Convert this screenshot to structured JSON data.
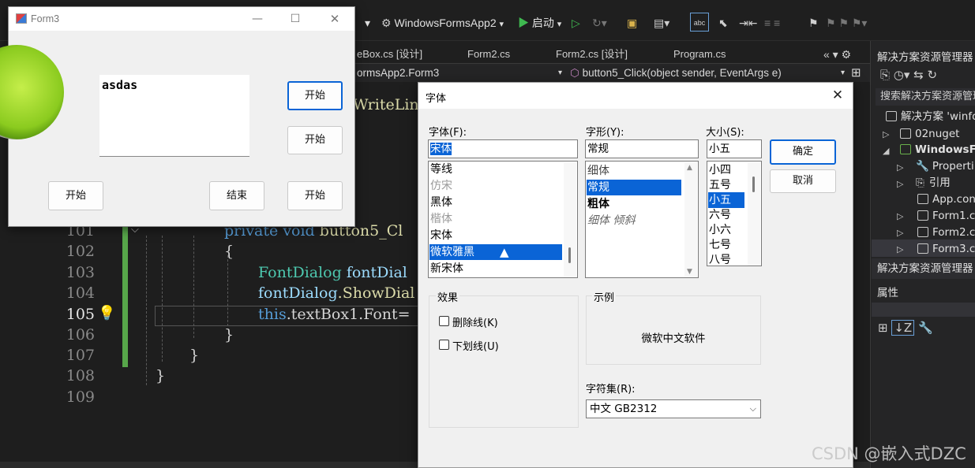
{
  "vs": {
    "toolbar": {
      "project_name": "WindowsFormsApp2",
      "run_label": "启动"
    },
    "tabs": [
      "eBox.cs [设计]",
      "Form2.cs",
      "Form2.cs [设计]",
      "Program.cs"
    ],
    "nav": {
      "class_combo": "ormsApp2.Form3",
      "member_combo": "button5_Click(object sender, EventArgs e)"
    },
    "code_partial": "WriteLin",
    "line_numbers": [
      "101",
      "102",
      "103",
      "104",
      "105",
      "106",
      "107",
      "108",
      "109"
    ],
    "current_line": "105",
    "code_lines": {
      "l101": {
        "kw1": "private",
        "kw2": "void",
        "fn": "button5_Cl"
      },
      "l102": "{",
      "l103": {
        "ty": "FontDialog",
        "vr": "fontDial"
      },
      "l104": {
        "vr": "fontDialog",
        "fn": ".ShowDial"
      },
      "l105": {
        "kw": "this",
        "rest": ".textBox1.Font="
      },
      "l106": "}",
      "l107": "}",
      "l108": "}"
    }
  },
  "solution_explorer": {
    "title": "解决方案资源管理器",
    "search_placeholder": "搜索解决方案资源管理",
    "items": [
      {
        "label": "解决方案 'winfo"
      },
      {
        "label": "02nuget"
      },
      {
        "label": "WindowsFo"
      },
      {
        "label": "Properti"
      },
      {
        "label": "引用"
      },
      {
        "label": "App.con"
      },
      {
        "label": "Form1.c"
      },
      {
        "label": "Form2.c"
      },
      {
        "label": "Form3.c"
      }
    ],
    "footer_title": "解决方案资源管理器",
    "properties_title": "属性"
  },
  "form3": {
    "title": "Form3",
    "textbox_text": "asdas",
    "buttons": {
      "right_top": "开始",
      "right_mid": "开始",
      "bottom_left": "开始",
      "bottom_mid": "结束",
      "bottom_right": "开始"
    }
  },
  "font_dialog": {
    "title": "字体",
    "font_label": "字体(F):",
    "font_value": "宋体",
    "font_list": [
      "等线",
      "仿宋",
      "黑体",
      "楷体",
      "宋体",
      "微软雅黑",
      "新宋体"
    ],
    "font_selected": "微软雅黑",
    "style_label": "字形(Y):",
    "style_value": "常规",
    "style_list": [
      "细体",
      "常规",
      "粗体",
      "细体 倾斜"
    ],
    "style_selected": "常规",
    "size_label": "大小(S):",
    "size_value": "小五",
    "size_list": [
      "小四",
      "五号",
      "小五",
      "六号",
      "小六",
      "七号",
      "八号"
    ],
    "size_selected": "小五",
    "ok_label": "确定",
    "cancel_label": "取消",
    "effects_label": "效果",
    "strikeout_label": "删除线(K)",
    "underline_label": "下划线(U)",
    "sample_label": "示例",
    "sample_text": "微软中文软件",
    "charset_label": "字符集(R):",
    "charset_value": "中文 GB2312"
  },
  "watermark": "CSDN @嵌入式DZC",
  "colors": {
    "accent": "#0a64d6",
    "editor_bg": "#1e1e1e",
    "changebar": "#57a64a"
  }
}
